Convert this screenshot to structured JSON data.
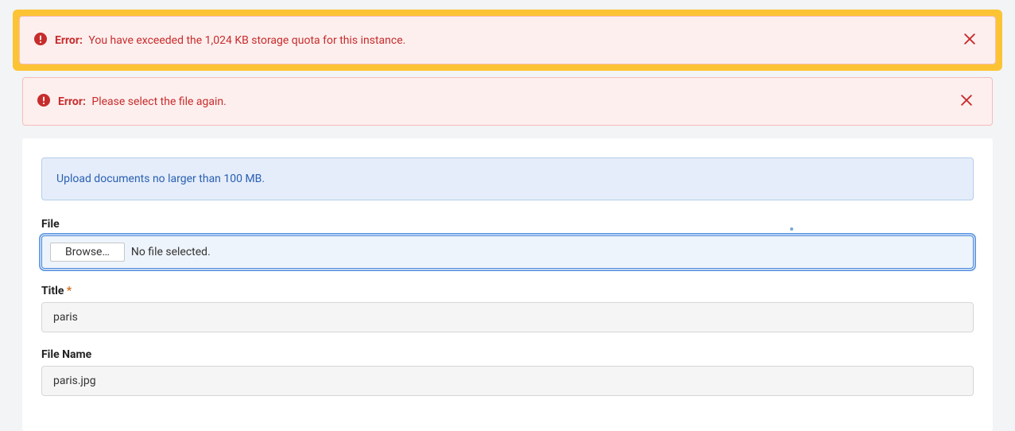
{
  "alerts": {
    "error1": {
      "label": "Error:",
      "message": "You have exceeded the 1,024 KB storage quota for this instance."
    },
    "error2": {
      "label": "Error:",
      "message": "Please select the file again."
    }
  },
  "info_banner": "Upload documents no larger than 100 MB.",
  "form": {
    "file": {
      "label": "File",
      "browse": "Browse…",
      "status": "No file selected."
    },
    "title": {
      "label": "Title",
      "required": "*",
      "value": "paris"
    },
    "filename": {
      "label": "File Name",
      "value": "paris.jpg"
    }
  }
}
